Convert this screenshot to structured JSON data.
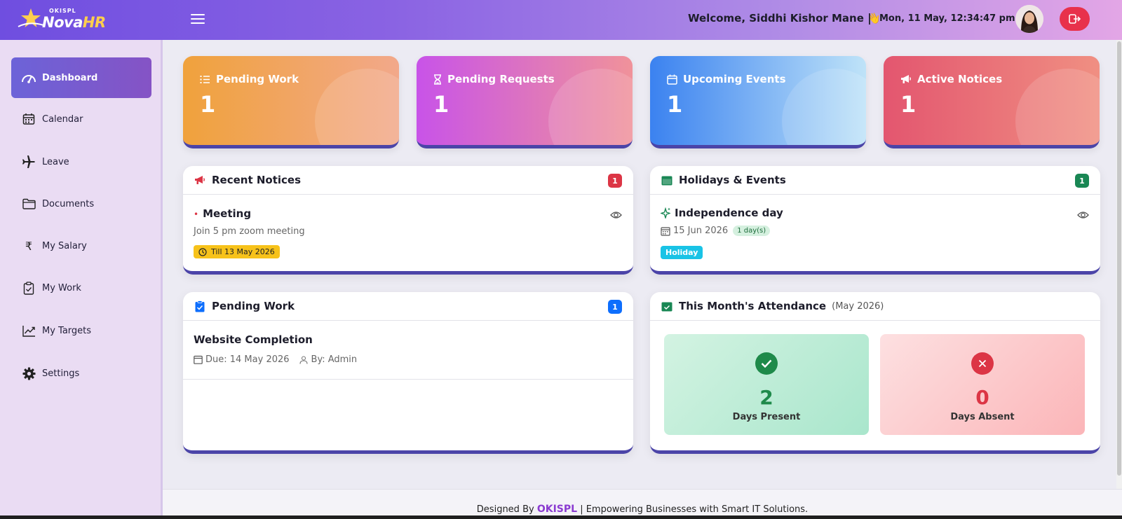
{
  "header": {
    "logo_small": "OKISPL",
    "logo_nova": "Nova",
    "logo_hr": "HR",
    "welcome": "Welcome, Siddhi Kishor Mane 👋",
    "separator": "|",
    "datetime": "Mon, 11 May, 12:34:47 pm"
  },
  "sidebar": {
    "items": [
      {
        "label": "Dashboard",
        "icon": "speedometer-icon"
      },
      {
        "label": "Calendar",
        "icon": "calendar-icon"
      },
      {
        "label": "Leave",
        "icon": "airplane-icon"
      },
      {
        "label": "Documents",
        "icon": "folder-icon"
      },
      {
        "label": "My Salary",
        "icon": "rupee-icon"
      },
      {
        "label": "My Work",
        "icon": "clipboard-icon"
      },
      {
        "label": "My Targets",
        "icon": "trend-chart-icon"
      },
      {
        "label": "Settings",
        "icon": "gear-icon"
      }
    ]
  },
  "stats": [
    {
      "title": "Pending Work",
      "value": "1",
      "color_from": "#f0a23c",
      "color_to": "#f2a88a"
    },
    {
      "title": "Pending Requests",
      "value": "1",
      "color_from": "#c853e8",
      "color_to": "#f0929a"
    },
    {
      "title": "Upcoming Events",
      "value": "1",
      "color_from": "#3b82f0",
      "color_to": "#bfe3f8"
    },
    {
      "title": "Active Notices",
      "value": "1",
      "color_from": "#e3566f",
      "color_to": "#f08f82"
    }
  ],
  "notices": {
    "title": "Recent Notices",
    "count": "1",
    "item": {
      "bullet": "•",
      "title": "Meeting",
      "desc": "Join 5 pm zoom meeting",
      "till": "Till 13 May 2026"
    }
  },
  "holidays": {
    "title": "Holidays & Events",
    "count": "1",
    "item": {
      "title": "Independence day",
      "date": "15 Jun 2026",
      "duration": "1 day(s)",
      "type": "Holiday"
    }
  },
  "pending_work": {
    "title": "Pending Work",
    "count": "1",
    "item": {
      "title": "Website Completion",
      "due": "Due: 14 May 2026",
      "by": "By: Admin"
    }
  },
  "attendance": {
    "title": "This Month's Attendance",
    "subtitle": "(May 2026)",
    "present_value": "2",
    "present_label": "Days Present",
    "absent_value": "0",
    "absent_label": "Days Absent"
  },
  "footer": {
    "prefix": "Designed By",
    "brand": "OKISPL",
    "suffix": "| Empowering Businesses with Smart IT Solutions."
  },
  "colors": {
    "accent": "#4b44a8",
    "danger": "#e8314b",
    "success": "#1e8a4a",
    "notice_badge": "#dc3545",
    "holiday_badge": "#198754",
    "work_badge": "#0d6efd"
  }
}
